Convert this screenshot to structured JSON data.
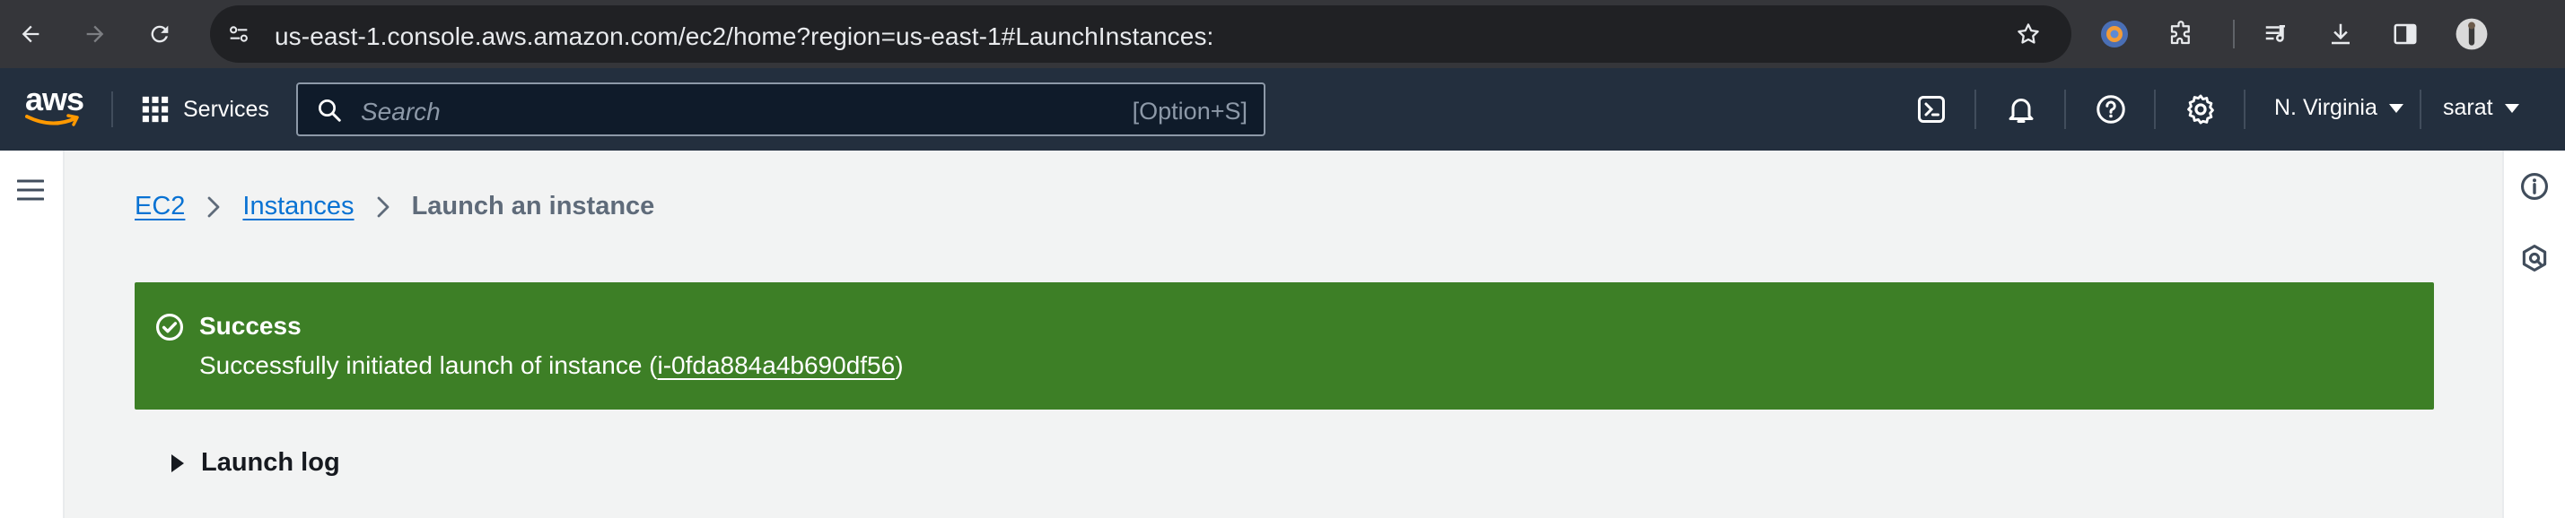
{
  "browser": {
    "url": "us-east-1.console.aws.amazon.com/ec2/home?region=us-east-1#LaunchInstances:"
  },
  "aws_nav": {
    "logo_text": "aws",
    "services_label": "Services",
    "search_placeholder": "Search",
    "search_shortcut": "[Option+S]",
    "region_label": "N. Virginia",
    "user_label": "sarat"
  },
  "breadcrumb": {
    "items": [
      {
        "label": "EC2"
      },
      {
        "label": "Instances"
      }
    ],
    "current": "Launch an instance"
  },
  "flash": {
    "title": "Success",
    "message_prefix": "Successfully initiated launch of instance (",
    "instance_id": "i-0fda884a4b690df56",
    "message_suffix": ")",
    "color": "#3d7f26"
  },
  "launch_log": {
    "label": "Launch log"
  },
  "colors": {
    "aws_nav_bg": "#232f3e",
    "link": "#0972d3",
    "page_bg": "#f2f3f3"
  }
}
